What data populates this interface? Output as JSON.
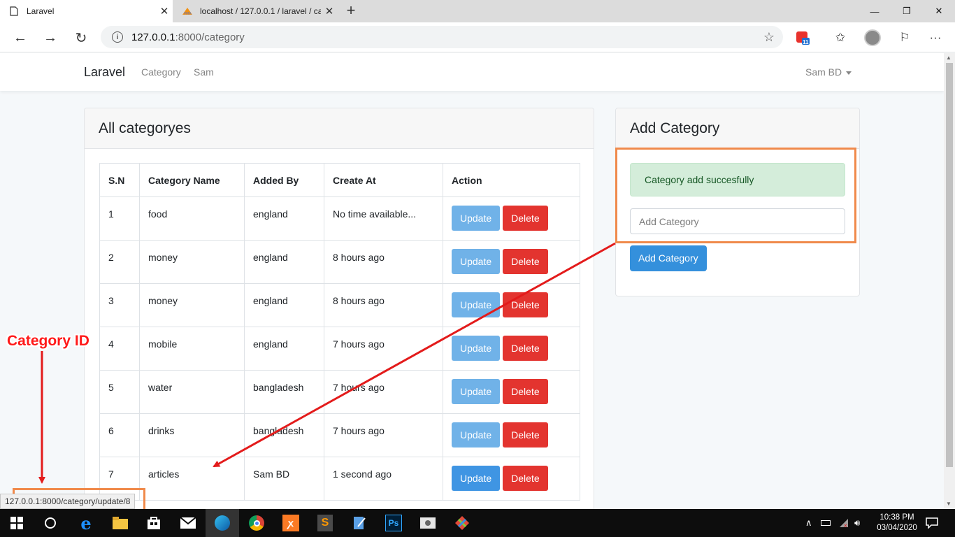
{
  "browser": {
    "tabs": [
      {
        "title": "Laravel"
      },
      {
        "title": "localhost / 127.0.0.1 / laravel / ca"
      }
    ],
    "url_host": "127.0.0.1",
    "url_rest": ":8000/category",
    "extension_badge": "11"
  },
  "navbar": {
    "brand": "Laravel",
    "links": [
      "Category",
      "Sam"
    ],
    "user": "Sam BD"
  },
  "list_card": {
    "title": "All categoryes",
    "columns": [
      "S.N",
      "Category Name",
      "Added By",
      "Create At",
      "Action"
    ],
    "rows": [
      {
        "sn": "1",
        "name": "food",
        "added_by": "england",
        "created": "No time available..."
      },
      {
        "sn": "2",
        "name": "money",
        "added_by": "england",
        "created": "8 hours ago"
      },
      {
        "sn": "3",
        "name": "money",
        "added_by": "england",
        "created": "8 hours ago"
      },
      {
        "sn": "4",
        "name": "mobile",
        "added_by": "england",
        "created": "7 hours ago"
      },
      {
        "sn": "5",
        "name": "water",
        "added_by": "bangladesh",
        "created": "7 hours ago"
      },
      {
        "sn": "6",
        "name": "drinks",
        "added_by": "bangladesh",
        "created": "7 hours ago"
      },
      {
        "sn": "7",
        "name": "articles",
        "added_by": "Sam BD",
        "created": "1 second ago"
      }
    ],
    "update_label": "Update",
    "delete_label": "Delete"
  },
  "add_card": {
    "title": "Add Category",
    "alert": "Category add succesfully",
    "input_placeholder": "Add Category",
    "button": "Add Category"
  },
  "annotation": {
    "callout": "Category ID"
  },
  "status_bar": {
    "link": "127.0.0.1:8000/category/update/8"
  },
  "taskbar": {
    "time": "10:38 PM",
    "date": "03/04/2020"
  },
  "colors": {
    "primary": "#3490dc",
    "danger": "#e3342f",
    "success_bg": "#d4edda",
    "annotation_red": "#ff1a1a",
    "annotation_orange": "#f08a4b"
  }
}
